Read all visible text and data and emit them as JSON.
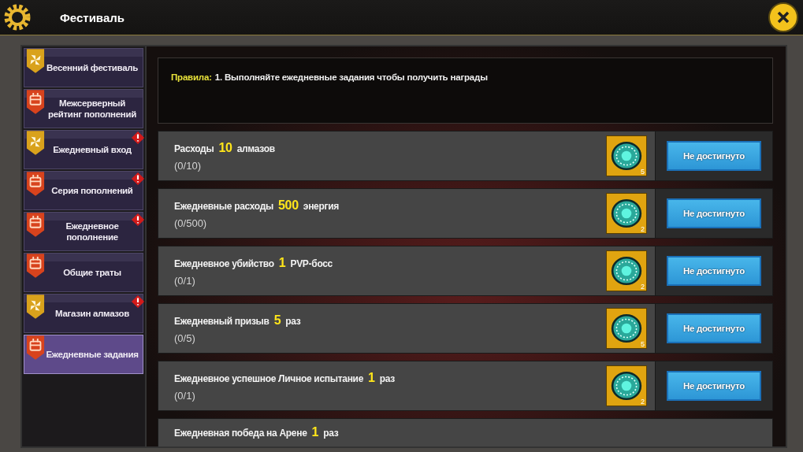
{
  "window": {
    "title": "Фестиваль"
  },
  "sidebar": {
    "items": [
      {
        "label": "Весенний фестиваль",
        "kind": "pinwheel",
        "alert": false,
        "selected": false
      },
      {
        "label": "Межсерверный рейтинг пополнений",
        "kind": "chest",
        "alert": false,
        "selected": false
      },
      {
        "label": "Ежедневный вход",
        "kind": "pinwheel",
        "alert": true,
        "selected": false
      },
      {
        "label": "Серия пополнений",
        "kind": "chest",
        "alert": true,
        "selected": false
      },
      {
        "label": "Ежедневное пополнение",
        "kind": "chest",
        "alert": true,
        "selected": false
      },
      {
        "label": "Общие траты",
        "kind": "chest",
        "alert": false,
        "selected": false
      },
      {
        "label": "Магазин алмазов",
        "kind": "pinwheel",
        "alert": true,
        "selected": false
      },
      {
        "label": "Ежедневные задания",
        "kind": "chest",
        "alert": false,
        "selected": true
      }
    ]
  },
  "rules": {
    "label": "Правила:",
    "text": "1. Выполняйте ежедневные задания чтобы получить награды"
  },
  "tasks": [
    {
      "title": "Расходы **10** алмазов",
      "progress": "(0/10)",
      "reward_count": "5",
      "button": "Не достигнуто"
    },
    {
      "title": "Ежедневные расходы **500** энергия",
      "progress": "(0/500)",
      "reward_count": "2",
      "button": "Не достигнуто"
    },
    {
      "title": "Ежедневное убийство **1** PVP-босс",
      "progress": "(0/1)",
      "reward_count": "2",
      "button": "Не достигнуто"
    },
    {
      "title": "Ежедневный призыв **5** раз",
      "progress": "(0/5)",
      "reward_count": "5",
      "button": "Не достигнуто"
    },
    {
      "title": "Ежедневное успешное Личное испытание **1** раз",
      "progress": "(0/1)",
      "reward_count": "2",
      "button": "Не достигнуто"
    },
    {
      "title": "Ежедневная победа на Арене **1** раз"
    }
  ]
}
